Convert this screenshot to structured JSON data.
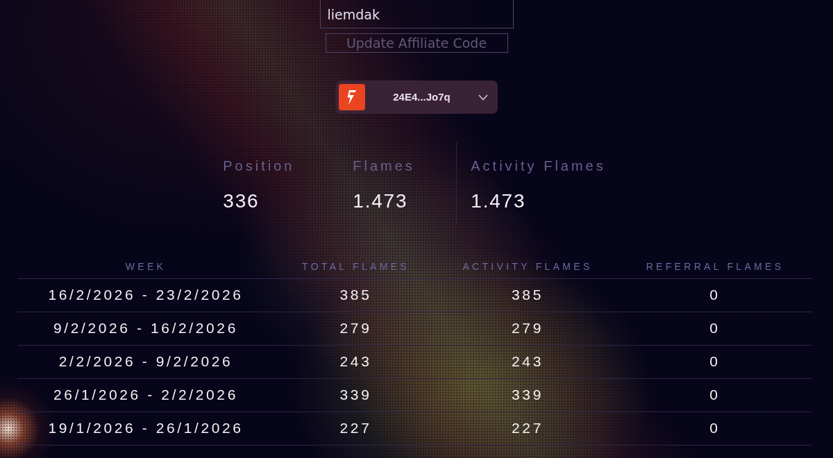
{
  "affiliate": {
    "code_field": {
      "value": "liemdak"
    },
    "update_button": {
      "label": "Update Affiliate Code",
      "disabled": true
    }
  },
  "wallet_selector": {
    "address": "24E4...Jo7q"
  },
  "stats": [
    {
      "label": "Position",
      "value": "336"
    },
    {
      "label": "Flames",
      "value": "1.473"
    },
    {
      "label": "Activity Flames",
      "value": "1.473"
    }
  ],
  "table": {
    "columns": [
      "WEEK",
      "TOTAL FLAMES",
      "ACTIVITY FLAMES",
      "REFERRAL FLAMES"
    ],
    "rows": [
      [
        "16/2/2026 - 23/2/2026",
        "385",
        "385",
        "0"
      ],
      [
        "9/2/2026 - 16/2/2026",
        "279",
        "279",
        "0"
      ],
      [
        "2/2/2026 - 9/2/2026",
        "243",
        "243",
        "0"
      ],
      [
        "26/1/2026 - 2/2/2026",
        "339",
        "339",
        "0"
      ],
      [
        "19/1/2026 - 26/1/2026",
        "227",
        "227",
        "0"
      ]
    ]
  }
}
